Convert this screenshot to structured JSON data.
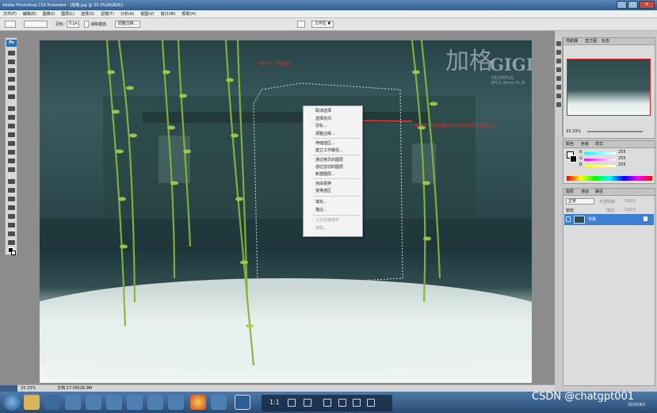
{
  "titlebar": {
    "title": "Adobe Photoshop CS3 Extended - [加格.jpg @ 33.3%(RGB/8)]"
  },
  "menu": {
    "items": [
      "文件(F)",
      "编辑(E)",
      "图像(I)",
      "图层(L)",
      "选择(S)",
      "滤镜(T)",
      "分析(A)",
      "视图(V)",
      "窗口(W)",
      "帮助(H)"
    ]
  },
  "options": {
    "feather_label": "羽化:",
    "feather_value": "0 px",
    "antialias_label": "消除锯齿",
    "refine_label": "调整边缘...",
    "workspace_label": "工作区 ▼"
  },
  "canvas": {
    "watermark_cn": "加格",
    "watermark_en": "GIGI",
    "watermark_sub1": "OLYMPUS",
    "watermark_sub2": "EPL5 (9mm F1.8)",
    "annotation1": "第一步：选择选区",
    "annotation2": "第二步：单击右键在弹出菜单中选择'选择反向'"
  },
  "context_menu": {
    "items": [
      {
        "label": "取消选择",
        "disabled": false
      },
      {
        "label": "选择反向",
        "disabled": false
      },
      {
        "label": "羽化...",
        "disabled": false
      },
      {
        "label": "调整边缘...",
        "disabled": false
      },
      {
        "label": "存储选区...",
        "disabled": false
      },
      {
        "label": "建立工作路径...",
        "disabled": false
      },
      {
        "label": "通过拷贝的图层",
        "disabled": false
      },
      {
        "label": "通过剪切的图层",
        "disabled": false
      },
      {
        "label": "新建图层...",
        "disabled": false
      },
      {
        "label": "自由变换",
        "disabled": false
      },
      {
        "label": "变换选区",
        "disabled": false
      },
      {
        "label": "填充...",
        "disabled": false
      },
      {
        "label": "描边...",
        "disabled": false
      },
      {
        "label": "上次滤镜操作",
        "disabled": true
      },
      {
        "label": "渐隐...",
        "disabled": true
      }
    ]
  },
  "status": {
    "zoom": "33.33%",
    "doc": "文档:17.0M/26.9M"
  },
  "panels": {
    "navigator_tabs": [
      "导航器",
      "直方图",
      "信息"
    ],
    "navigator_zoom": "33.33%",
    "color_tabs": [
      "颜色",
      "色板",
      "样式"
    ],
    "color_labels": [
      "R",
      "G",
      "B"
    ],
    "color_values": [
      "255",
      "255",
      "255"
    ],
    "layers_tabs": [
      "图层",
      "通道",
      "路径"
    ],
    "blend_mode": "正常",
    "opacity_label": "不透明度:",
    "opacity_value": "100%",
    "fill_label": "填充:",
    "fill_value": "100%",
    "lock_label": "锁定:",
    "layer_name": "背景"
  },
  "taskbar": {
    "csdn": "CSDN @chatgpt001",
    "date": "2015/4/1",
    "dock_label": "1:1"
  },
  "colors": {
    "accent": "#d6322a",
    "layer_selected": "#3d7fd0",
    "title_bg": "#2f5d8f"
  }
}
